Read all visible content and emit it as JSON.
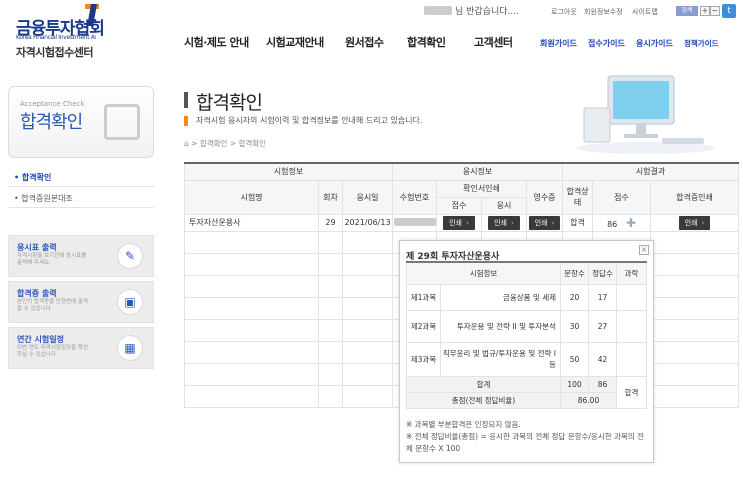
{
  "header": {
    "logo_title": "금융투자협회",
    "logo_subtitle": "Korea Financial Investment Association",
    "center_name": "자격시험접수센터",
    "welcome": "님 반갑습니다....",
    "util_links": [
      "로그아웃",
      "회원정보수정",
      "사이트맵"
    ],
    "search_label": "검색",
    "zoom": [
      "+",
      "−",
      "□"
    ],
    "gnb": [
      "시험·제도 안내",
      "시험교재안내",
      "원서접수",
      "합격확인",
      "고객센터"
    ],
    "quick_links": [
      "회원가이드",
      "접수가이드",
      "응시가이드",
      "정책가이드"
    ]
  },
  "sidebar": {
    "box_en": "Acceptance Check",
    "box_title": "합격확인",
    "menu": [
      "합격확인",
      "합격증원본대조"
    ],
    "promos": [
      {
        "title": "응시표 출력",
        "desc": "자격시험을 보기전에 응시표를 출력해 주세요.",
        "icon": "pencil-icon"
      },
      {
        "title": "합격증 출력",
        "desc": "본인의 합격증을 단한번에 출력할 수 있습니다.",
        "icon": "id-card-icon"
      },
      {
        "title": "연간 시험일정",
        "desc": "이번 연도 자격시험일정을 확인하실 수 있습니다.",
        "icon": "calendar-icon"
      }
    ]
  },
  "content": {
    "title": "합격확인",
    "description": "자격시험 응시자의 시험이력 및 합격정보를 안내해 드리고 있습니다.",
    "breadcrumb": "> 합격확인 > 합격확인"
  },
  "table": {
    "groups": [
      "시험정보",
      "응시정보",
      "시험결과"
    ],
    "cols": [
      "시험명",
      "회차",
      "응시일",
      "수험번호",
      "확인서인쇄",
      "영수증",
      "합격상태",
      "점수",
      "합격증인쇄"
    ],
    "subcols": [
      "접수",
      "응시"
    ],
    "row": {
      "exam": "투자자산운용사",
      "round": "29",
      "date": "2021/06/13",
      "print1": "인쇄",
      "print2": "인쇄",
      "receipt": "인쇄",
      "status": "합격",
      "score": "86",
      "cert": "인쇄"
    }
  },
  "popup": {
    "title": "제 29회 투자자산운용사",
    "headers": [
      "시험정보",
      "문항수",
      "정답수",
      "과락"
    ],
    "rows": [
      {
        "subject": "제1과목",
        "name": "금융상품 및 세제",
        "q": "20",
        "a": "17"
      },
      {
        "subject": "제2과목",
        "name": "투자운용 및 전략 II 및 투자분석",
        "q": "30",
        "a": "27"
      },
      {
        "subject": "제3과목",
        "name": "직무윤리 및 법규/투자운용 및 전략 I 등",
        "q": "50",
        "a": "42"
      }
    ],
    "total_label": "합계",
    "total_q": "100",
    "total_a": "86",
    "rate_label": "총점(전체 정답비율)",
    "rate": "86.00",
    "result": "합격",
    "note1": "※ 과목별 부분합격은 인정되지 않음.",
    "note2": "※ 전체 정답비율(총점) = 응시한 과목의 전체 정답 문항수/응시한 과목의 전체 문항수 X 100"
  }
}
